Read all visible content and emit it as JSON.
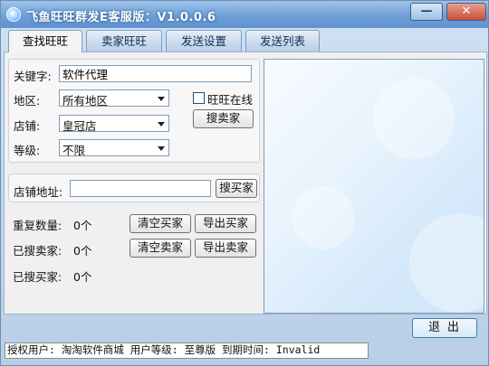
{
  "window": {
    "title": "飞鱼旺旺群发E客服版：V1.0.0.6",
    "minimize_label": "—",
    "close_label": "✕"
  },
  "tabs": [
    {
      "label": "查找旺旺",
      "active": true
    },
    {
      "label": "卖家旺旺",
      "active": false
    },
    {
      "label": "发送设置",
      "active": false
    },
    {
      "label": "发送列表",
      "active": false
    }
  ],
  "search": {
    "keyword_label": "关键字:",
    "keyword_value": "软件代理",
    "region_label": "地区:",
    "region_value": "所有地区",
    "shop_label": "店铺:",
    "shop_value": "皇冠店",
    "level_label": "等级:",
    "level_value": "不限",
    "online_checkbox_label": "旺旺在线",
    "online_checked": false,
    "search_sellers_button": "搜卖家"
  },
  "store_address": {
    "label": "店铺地址:",
    "value": "",
    "search_buyers_button": "搜买家"
  },
  "counters": {
    "duplicate_label": "重复数量:",
    "duplicate_value": "0个",
    "clear_buyers_button": "清空买家",
    "export_buyers_button": "导出买家",
    "searched_sellers_label": "已搜卖家:",
    "searched_sellers_value": "0个",
    "clear_sellers_button": "清空卖家",
    "export_sellers_button": "导出卖家",
    "searched_buyers_label": "已搜买家:",
    "searched_buyers_value": "0个"
  },
  "exit_button": "退出",
  "statusbar": {
    "text": "授权用户: 淘淘软件商城  用户等级: 至尊版 到期时间: Invalid"
  }
}
